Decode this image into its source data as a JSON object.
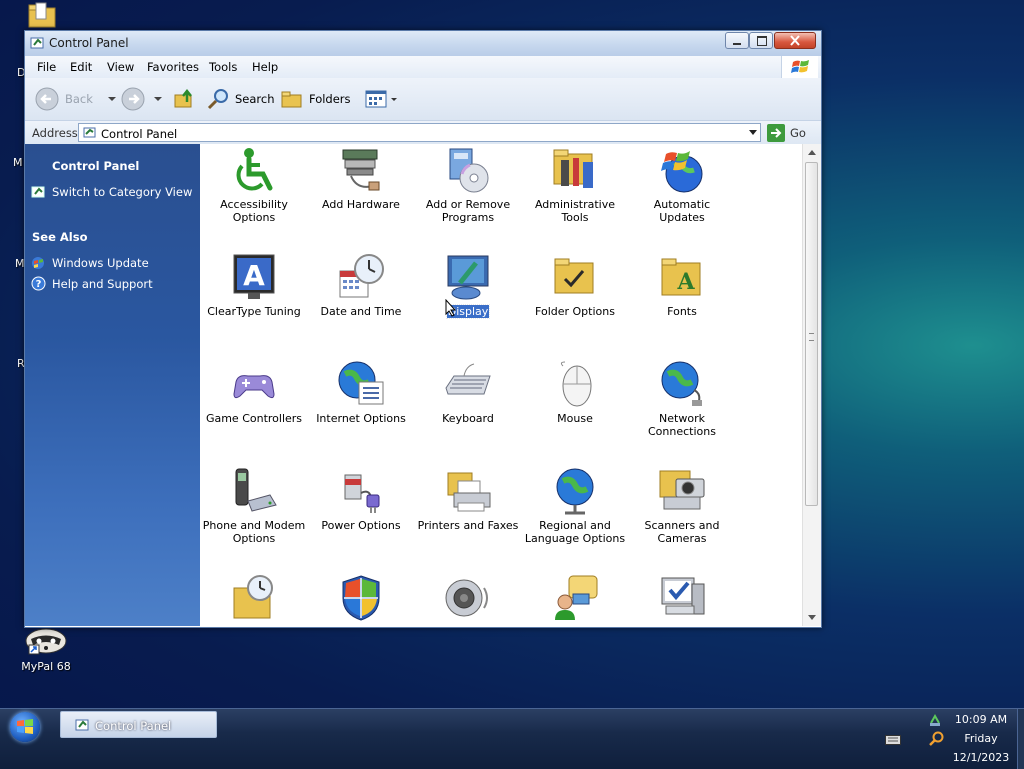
{
  "desktop": {
    "icons": [
      {
        "label": "MyPal 68"
      }
    ],
    "edge_letters": [
      "D",
      "M",
      "M",
      "R"
    ]
  },
  "window": {
    "title": "Control Panel",
    "menu": [
      "File",
      "Edit",
      "View",
      "Favorites",
      "Tools",
      "Help"
    ],
    "toolbar": {
      "back_label": "Back",
      "search_label": "Search",
      "folders_label": "Folders"
    },
    "address": {
      "label": "Address",
      "value": "Control Panel",
      "go_label": "Go"
    },
    "left_pane": {
      "heading": "Control Panel",
      "switch_link": "Switch to Category View",
      "see_also_heading": "See Also",
      "see_also_links": [
        "Windows Update",
        "Help and Support"
      ]
    },
    "items": [
      {
        "label": "Accessibility Options",
        "icon": "accessibility-icon"
      },
      {
        "label": "Add Hardware",
        "icon": "add-hardware-icon"
      },
      {
        "label": "Add or Remove Programs",
        "icon": "add-remove-programs-icon"
      },
      {
        "label": "Administrative Tools",
        "icon": "administrative-tools-icon"
      },
      {
        "label": "Automatic Updates",
        "icon": "automatic-updates-icon"
      },
      {
        "label": "ClearType Tuning",
        "icon": "cleartype-icon"
      },
      {
        "label": "Date and Time",
        "icon": "date-time-icon"
      },
      {
        "label": "Display",
        "icon": "display-icon",
        "selected": true
      },
      {
        "label": "Folder Options",
        "icon": "folder-options-icon"
      },
      {
        "label": "Fonts",
        "icon": "fonts-icon"
      },
      {
        "label": "Game Controllers",
        "icon": "game-controller-icon"
      },
      {
        "label": "Internet Options",
        "icon": "internet-options-icon"
      },
      {
        "label": "Keyboard",
        "icon": "keyboard-icon"
      },
      {
        "label": "Mouse",
        "icon": "mouse-icon"
      },
      {
        "label": "Network Connections",
        "icon": "network-icon"
      },
      {
        "label": "Phone and Modem Options",
        "icon": "phone-modem-icon"
      },
      {
        "label": "Power Options",
        "icon": "power-icon"
      },
      {
        "label": "Printers and Faxes",
        "icon": "printer-icon"
      },
      {
        "label": "Regional and Language Options",
        "icon": "regional-icon"
      },
      {
        "label": "Scanners and Cameras",
        "icon": "scanner-camera-icon"
      },
      {
        "label": "",
        "icon": "scheduled-tasks-icon"
      },
      {
        "label": "",
        "icon": "security-center-icon"
      },
      {
        "label": "",
        "icon": "sounds-icon"
      },
      {
        "label": "",
        "icon": "speech-icon"
      },
      {
        "label": "",
        "icon": "system-icon"
      }
    ]
  },
  "taskbar": {
    "task_label": "Control Panel",
    "time": "10:09 AM",
    "day": "Friday",
    "date": "12/1/2023"
  }
}
